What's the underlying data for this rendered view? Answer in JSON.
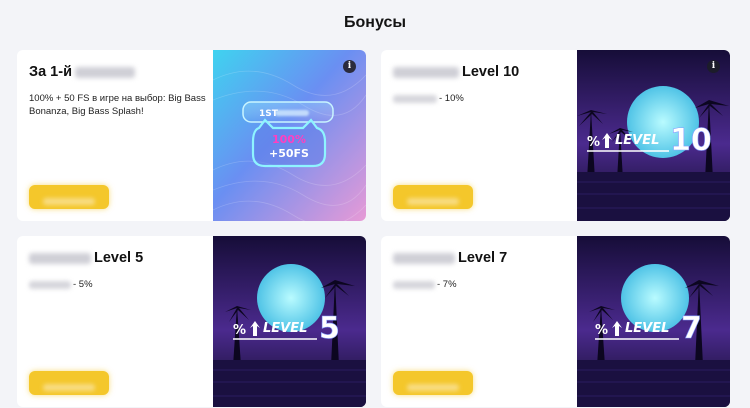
{
  "page": {
    "title": "Бонусы"
  },
  "cards": [
    {
      "title_prefix": "За 1-й",
      "title_suffix": "",
      "desc_prefix": "",
      "desc": "100% + 50 FS в игре на выбор: Big Bass Bonanza, Big Bass Splash!",
      "image": {
        "badge_top": "1ST",
        "badge_pct": "100%",
        "badge_fs": "+50FS"
      }
    },
    {
      "title_prefix": "",
      "title_suffix": "Level 10",
      "desc": "- 10%",
      "image": {
        "level_word": "LEVEL",
        "level_num": "10"
      }
    },
    {
      "title_prefix": "",
      "title_suffix": "Level 5",
      "desc": "- 5%",
      "image": {
        "level_word": "LEVEL",
        "level_num": "5"
      }
    },
    {
      "title_prefix": "",
      "title_suffix": "Level 7",
      "desc": "- 7%",
      "image": {
        "level_word": "LEVEL",
        "level_num": "7"
      }
    }
  ],
  "info_icon_symbol": "i",
  "colors": {
    "button": "#f4c72b",
    "background": "#f3f4f8",
    "card": "#ffffff"
  }
}
